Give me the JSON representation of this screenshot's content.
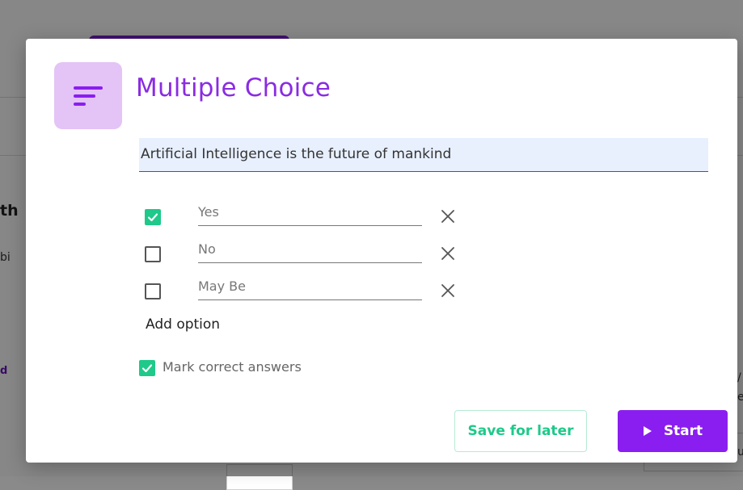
{
  "background": {
    "left_text_1": "th",
    "left_text_2": "bi",
    "left_text_3": "d",
    "right_text_1": "/",
    "right_text_2": "e",
    "right_text_3": "u"
  },
  "modal": {
    "title": "Multiple Choice",
    "icon": "text-lines-icon",
    "question": "Artificial Intelligence is the future of mankind",
    "options": [
      {
        "label": "Yes",
        "checked": true
      },
      {
        "label": "No",
        "checked": false
      },
      {
        "label": "May Be",
        "checked": false
      }
    ],
    "add_option_label": "Add option",
    "mark_correct_label": "Mark correct answers",
    "mark_correct_checked": true,
    "save_label": "Save for later",
    "start_label": "Start"
  },
  "colors": {
    "accent_purple": "#8a2be2",
    "start_button": "#8a1ef0",
    "check_green": "#1ec98a",
    "icon_bg": "#e4c3f6",
    "question_bg": "#e8f0fe"
  }
}
